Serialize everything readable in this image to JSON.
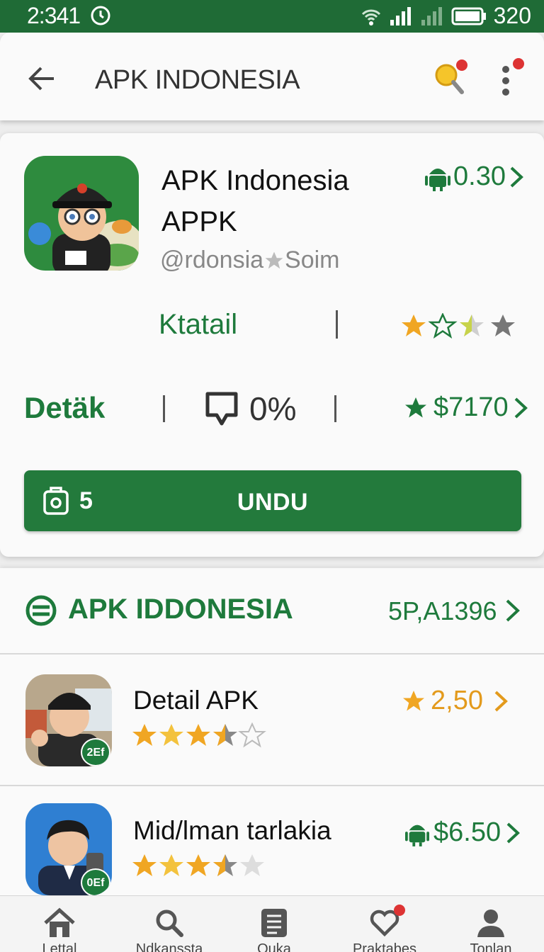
{
  "status_bar": {
    "time": "2:341",
    "battery": "320"
  },
  "app_bar": {
    "title": "APK INDONESIA"
  },
  "app_card": {
    "name_line1": "APK Indonesia",
    "name_line2": "APPK",
    "price": "0.30",
    "developer": "@rdonsia",
    "developer_suffix": "Soim",
    "category": "Ktatail",
    "rating_stars": 1.5,
    "detail_label": "Detäk",
    "percent": "0%",
    "size_price": "$7170",
    "download_count": "5",
    "download_label": "UNDU"
  },
  "section": {
    "title": "APK IDDONESIA",
    "count": "5P,A1396"
  },
  "items": [
    {
      "name": "Detail APK",
      "stars": 3.5,
      "price": "2,50",
      "badge": "2Ef",
      "price_color": "#e39a1c"
    },
    {
      "name": "Mid/lman tarlakia",
      "stars": 3.5,
      "price": "$6.50",
      "badge": "0Ef",
      "price_color": "#1e7a3c"
    }
  ],
  "bottom_nav": [
    {
      "label": "Lettal",
      "icon": "home-icon"
    },
    {
      "label": "Ndkanssta",
      "icon": "search-icon"
    },
    {
      "label": "Quka",
      "icon": "list-icon"
    },
    {
      "label": "Praktabes",
      "icon": "heart-icon"
    },
    {
      "label": "Tonlan",
      "icon": "person-icon"
    }
  ],
  "colors": {
    "brand": "#1f6b36",
    "accent_green": "#1e7a3c",
    "star_gold": "#f0a623"
  }
}
